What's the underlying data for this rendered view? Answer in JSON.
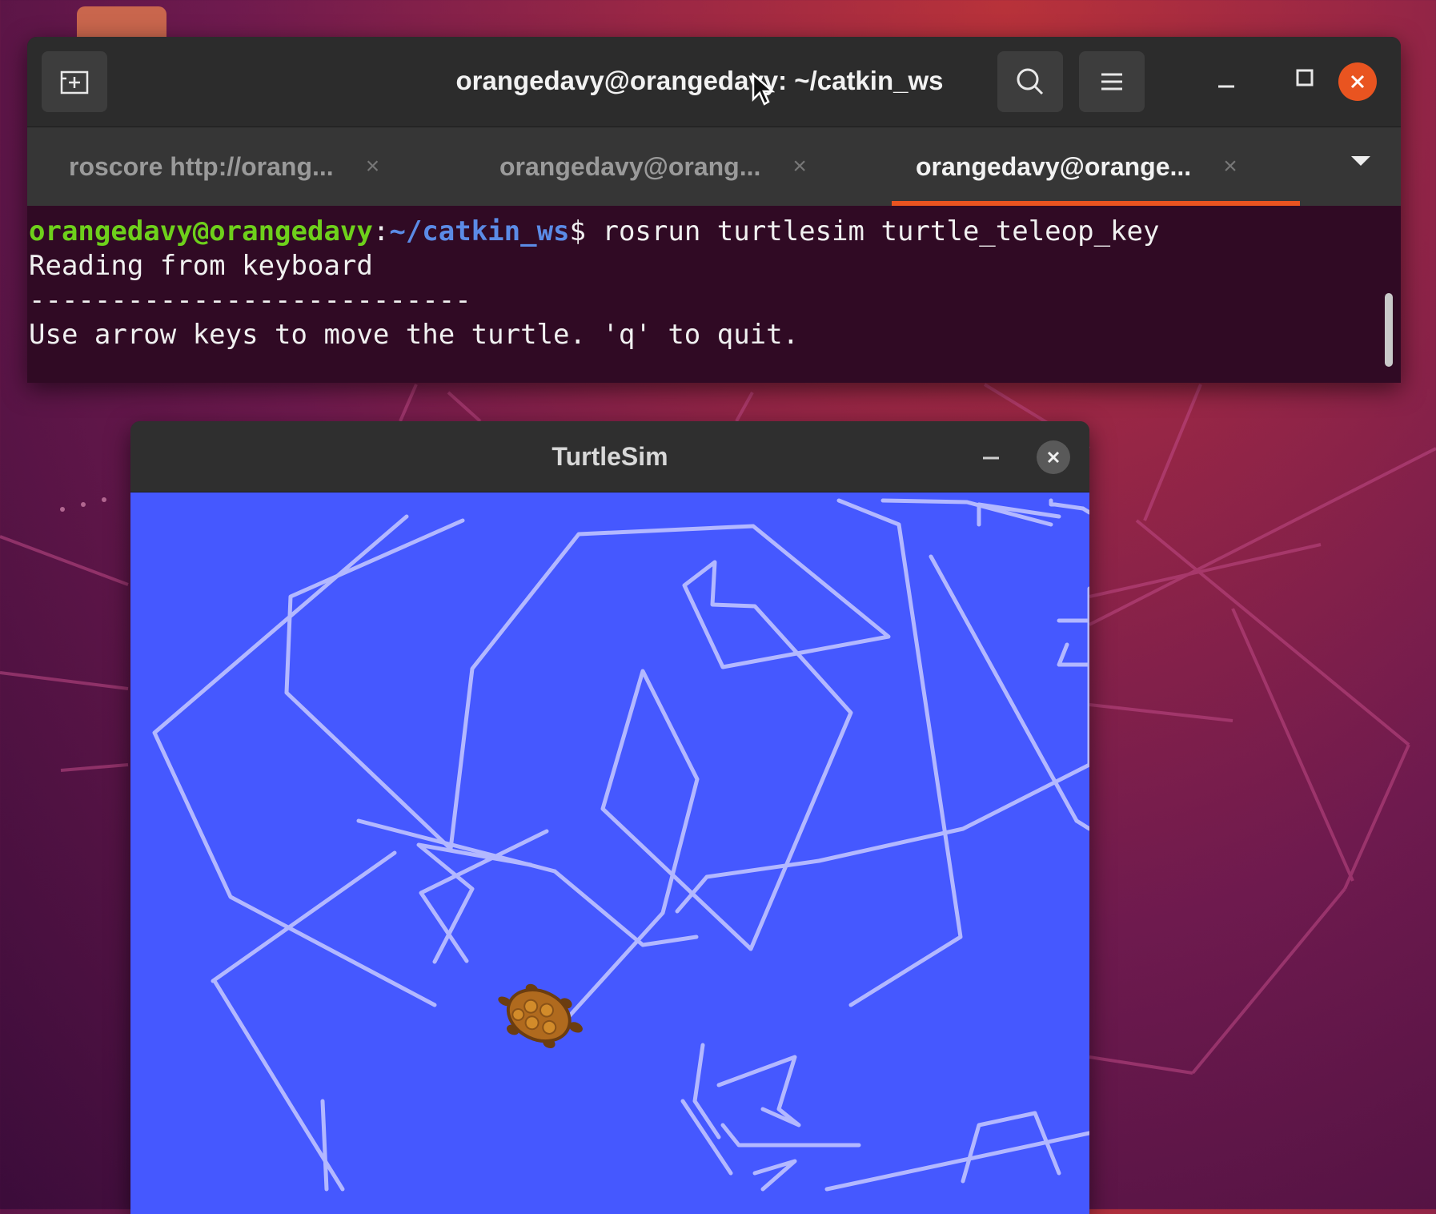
{
  "terminal": {
    "title": "orangedavy@orangedavy: ~/catkin_ws",
    "tabs": [
      {
        "label": "roscore http://orang...",
        "active": false
      },
      {
        "label": "orangedavy@orang...",
        "active": false
      },
      {
        "label": "orangedavy@orange...",
        "active": true
      }
    ],
    "prompt_user": "orangedavy@orangedavy",
    "prompt_sep": ":",
    "prompt_path": "~/catkin_ws",
    "prompt_symbol": "$ ",
    "command": "rosrun turtlesim turtle_teleop_key",
    "output_lines": [
      "Reading from keyboard",
      "---------------------------",
      "Use arrow keys to move the turtle. 'q' to quit."
    ]
  },
  "turtlesim": {
    "title": "TurtleSim",
    "background_color": "#4558ff",
    "pen_color": "#b3b8ff"
  },
  "colors": {
    "accent": "#e95420",
    "terminal_bg": "#300a24"
  },
  "icons": [
    "new-tab-icon",
    "search-icon",
    "hamburger-menu-icon",
    "minimize-icon",
    "maximize-icon",
    "close-icon",
    "dropdown-arrow-icon",
    "turtle-icon"
  ]
}
